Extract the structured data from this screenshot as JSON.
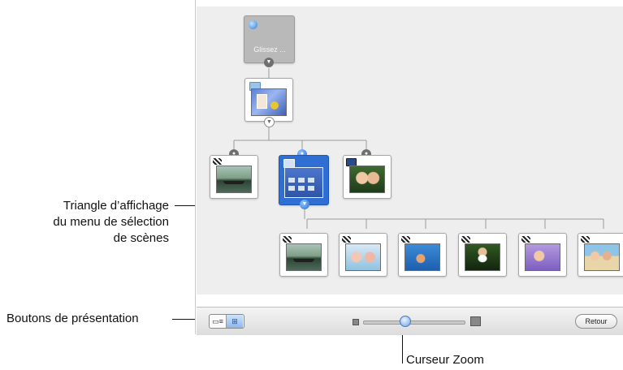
{
  "callouts": {
    "disclosure_triangle": [
      "Triangle d’affichage",
      "du menu de sélection",
      "de scènes"
    ],
    "presentation_buttons": "Boutons de présentation",
    "zoom_slider": "Curseur Zoom"
  },
  "canvas": {
    "drop_placeholder": "Glissez ...",
    "menu_nodes": [
      {
        "kind": "menu",
        "thumb": "menu-theme-preview"
      },
      {
        "kind": "menu",
        "thumb": "scene-selection-menu",
        "selected": true
      }
    ],
    "movie_nodes": [
      {
        "kind": "movie",
        "thumb": "lake-boat-photo"
      },
      {
        "kind": "slideshow",
        "thumb": "two-girls-photo"
      }
    ],
    "scene_nodes": [
      {
        "thumb": "lake-boat-photo"
      },
      {
        "thumb": "children-pool-photo"
      },
      {
        "thumb": "water-ski-photo"
      },
      {
        "thumb": "girl-portrait-photo"
      },
      {
        "thumb": "kids-purple-photo"
      },
      {
        "thumb": "family-beach-photo"
      }
    ]
  },
  "toolbar": {
    "back_label": "Retour",
    "view_list_icon": "list-view-icon",
    "view_tree_icon": "tree-view-icon"
  },
  "zoom": {
    "value": 0.37
  },
  "colors": {
    "selection": "#2f6fd4",
    "scrollbar": "#6aa2ea"
  }
}
